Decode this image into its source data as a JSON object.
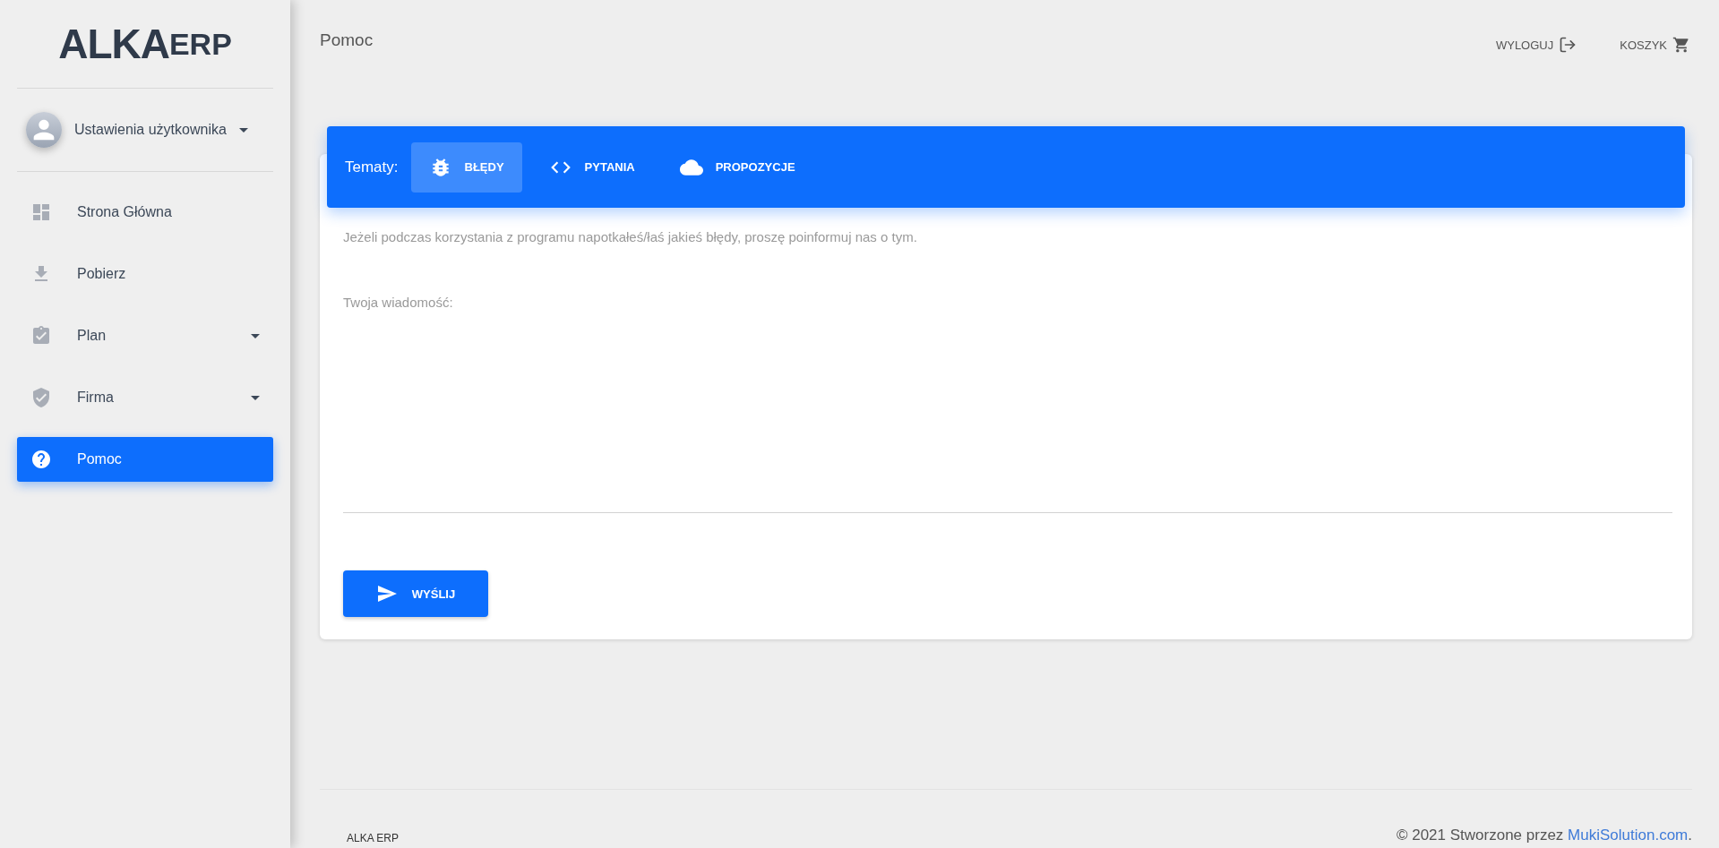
{
  "sidebar": {
    "logo": {
      "main": "ALKA",
      "sub": "ERP"
    },
    "user": {
      "label": "Ustawienia użytkownika"
    },
    "items": [
      {
        "label": "Strona Główna",
        "expandable": false,
        "selected": false
      },
      {
        "label": "Pobierz",
        "expandable": false,
        "selected": false
      },
      {
        "label": "Plan",
        "expandable": true,
        "selected": false
      },
      {
        "label": "Firma",
        "expandable": true,
        "selected": false
      },
      {
        "label": "Pomoc",
        "expandable": false,
        "selected": true
      }
    ]
  },
  "header": {
    "title": "Pomoc",
    "actions": [
      {
        "label": "WYLOGUJ"
      },
      {
        "label": "KOSZYK"
      }
    ]
  },
  "help": {
    "topics_label": "Tematy:",
    "tabs": [
      {
        "label": "BŁĘDY",
        "selected": true
      },
      {
        "label": "PYTANIA",
        "selected": false
      },
      {
        "label": "PROPOZYCJE",
        "selected": false
      }
    ],
    "description": "Jeżeli podczas korzystania z programu napotkałeś/łaś jakieś błędy, proszę poinformuj nas o tym.",
    "message_label": "Twoja wiadomość:",
    "send_button": "WYŚLIJ"
  },
  "footer": {
    "brand": "ALKA ERP",
    "copyright": "© 2021 Stworzone przez ",
    "link": "MukiSolution.com",
    "suffix": "."
  }
}
